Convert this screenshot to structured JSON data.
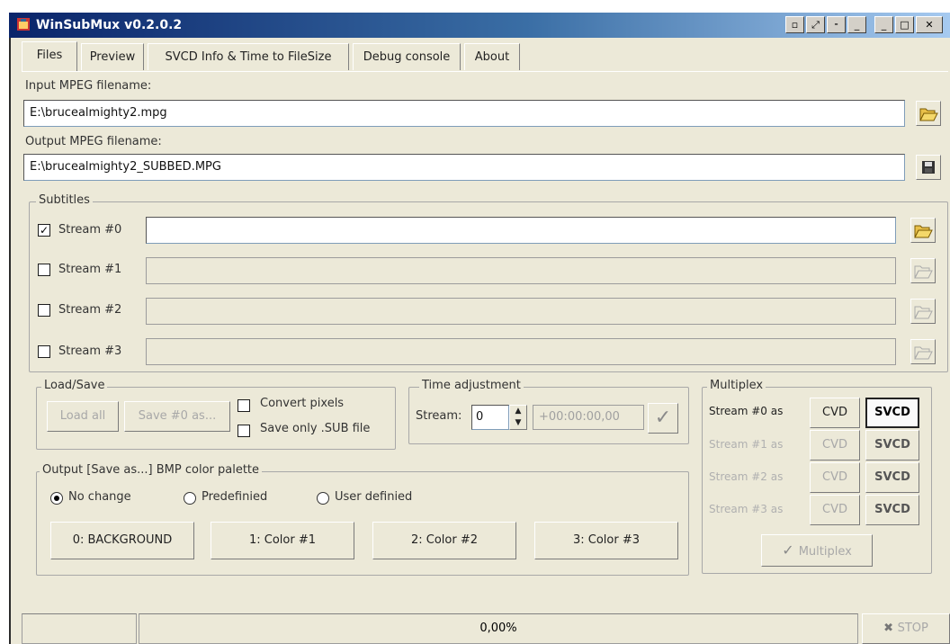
{
  "window": {
    "title": "WinSubMux v0.2.0.2"
  },
  "tabs": [
    "Files",
    "Preview",
    "SVCD Info & Time to FileSize",
    "Debug console",
    "About"
  ],
  "input": {
    "label": "Input MPEG filename:",
    "value": "E:\\brucealmighty2.mpg"
  },
  "output": {
    "label": "Output MPEG filename:",
    "value": "E:\\brucealmighty2_SUBBED.MPG"
  },
  "subtitles": {
    "title": "Subtitles",
    "streams": [
      "Stream #0",
      "Stream #1",
      "Stream #2",
      "Stream #3"
    ]
  },
  "loadsave": {
    "title": "Load/Save",
    "load_label": "Load all",
    "save_label": "Save #0 as...",
    "convert_label": "Convert pixels",
    "sub_only_label": "Save only .SUB file"
  },
  "time": {
    "title": "Time adjustment",
    "stream_label": "Stream:",
    "stream_value": "0",
    "offset_placeholder": "+00:00:00,00"
  },
  "palette": {
    "title": "Output [Save as...] BMP color palette",
    "options": [
      "No change",
      "Predefinied",
      "User definied"
    ],
    "colors": [
      "0: BACKGROUND",
      "1: Color #1",
      "2: Color #2",
      "3: Color #3"
    ]
  },
  "multiplex": {
    "title": "Multiplex",
    "rows": [
      "Stream #0 as",
      "Stream #1 as",
      "Stream #2 as",
      "Stream #3 as"
    ],
    "cvd_label": "CVD",
    "svcd_label": "SVCD",
    "button_label": "Multiplex"
  },
  "status": {
    "progress": "0,00%",
    "stop_label": "STOP"
  }
}
